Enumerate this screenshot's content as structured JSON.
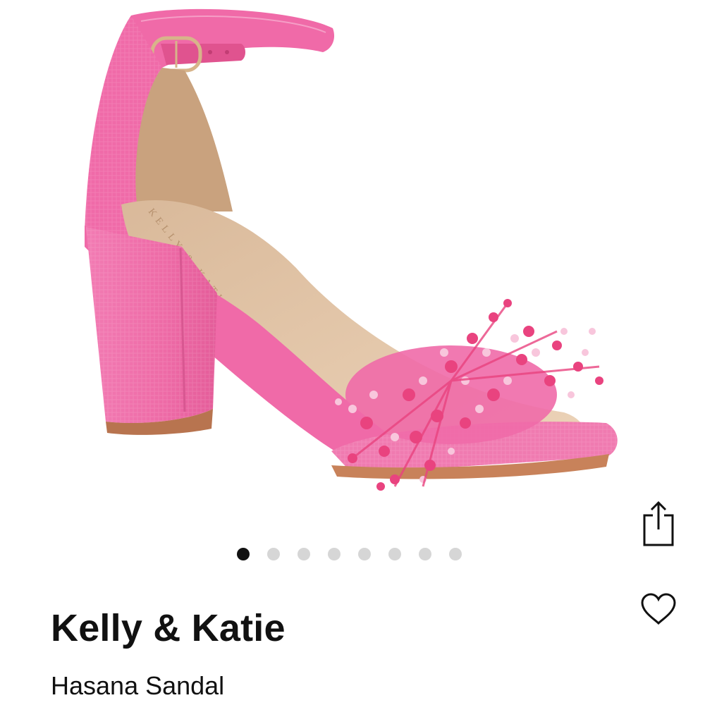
{
  "product": {
    "brand": "Kelly & Katie",
    "name": "Hasana Sandal",
    "image_alt": "Pink beaded block heel sandal",
    "insole_print": "KELLY & KATIE"
  },
  "carousel": {
    "dots": 8,
    "active_index": 0
  },
  "actions": {
    "share_icon": "share-icon",
    "favorite_icon": "heart-icon"
  },
  "colors": {
    "shoe_pink": "#f06aa8",
    "bead_pink": "#e9437f",
    "insole_tan": "#e6c8a8",
    "sole_brown": "#c8825a",
    "dot_active": "#111111",
    "dot_inactive": "#d6d6d6"
  }
}
